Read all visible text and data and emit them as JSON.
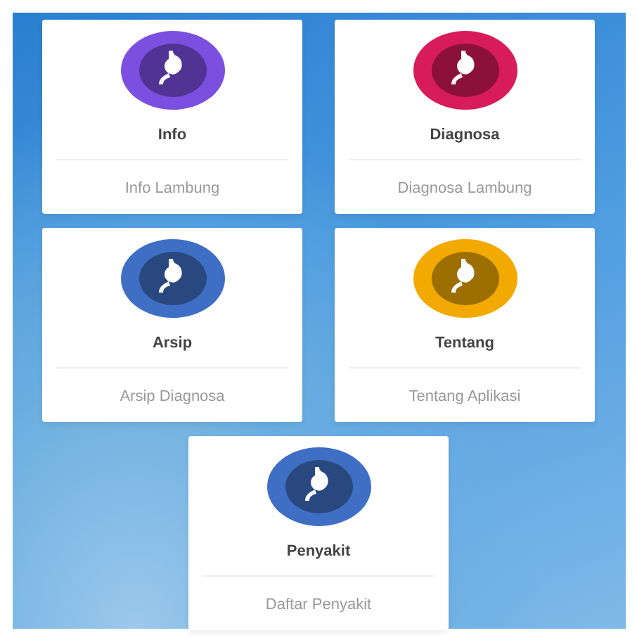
{
  "menu": [
    {
      "title": "Info",
      "subtitle": "Info Lambung",
      "color": "#7b4fe0"
    },
    {
      "title": "Diagnosa",
      "subtitle": "Diagnosa Lambung",
      "color": "#d81b5a"
    },
    {
      "title": "Arsip",
      "subtitle": "Arsip Diagnosa",
      "color": "#3f6fc4"
    },
    {
      "title": "Tentang",
      "subtitle": "Tentang Aplikasi",
      "color": "#f2a900"
    },
    {
      "title": "Penyakit",
      "subtitle": "Daftar Penyakit",
      "color": "#3f6fc4"
    }
  ]
}
